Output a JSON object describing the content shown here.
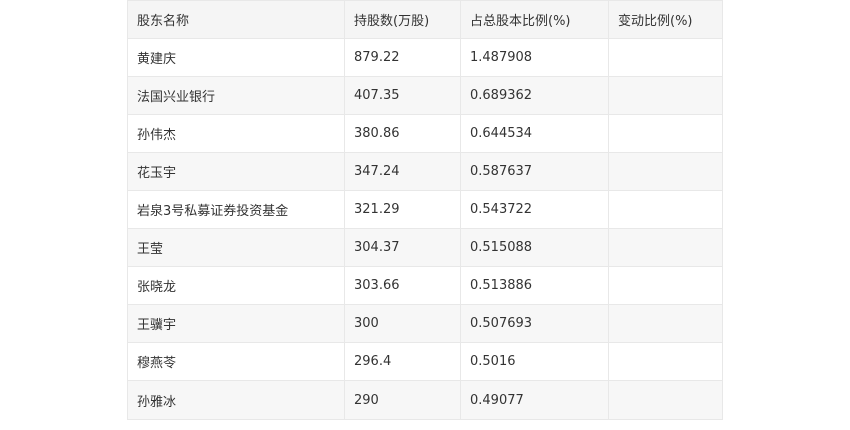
{
  "table": {
    "headers": [
      "股东名称",
      "持股数(万股)",
      "占总股本比例(%)",
      "变动比例(%)"
    ],
    "rows": [
      [
        "黄建庆",
        "879.22",
        "1.487908",
        ""
      ],
      [
        "法国兴业银行",
        "407.35",
        "0.689362",
        ""
      ],
      [
        "孙伟杰",
        "380.86",
        "0.644534",
        ""
      ],
      [
        "花玉宇",
        "347.24",
        "0.587637",
        ""
      ],
      [
        "岩泉3号私募证券投资基金",
        "321.29",
        "0.543722",
        ""
      ],
      [
        "王莹",
        "304.37",
        "0.515088",
        ""
      ],
      [
        "张晓龙",
        "303.66",
        "0.513886",
        ""
      ],
      [
        "王骥宇",
        "300",
        "0.507693",
        ""
      ],
      [
        "穆燕苓",
        "296.4",
        "0.5016",
        ""
      ],
      [
        "孙雅冰",
        "290",
        "0.49077",
        ""
      ]
    ]
  }
}
